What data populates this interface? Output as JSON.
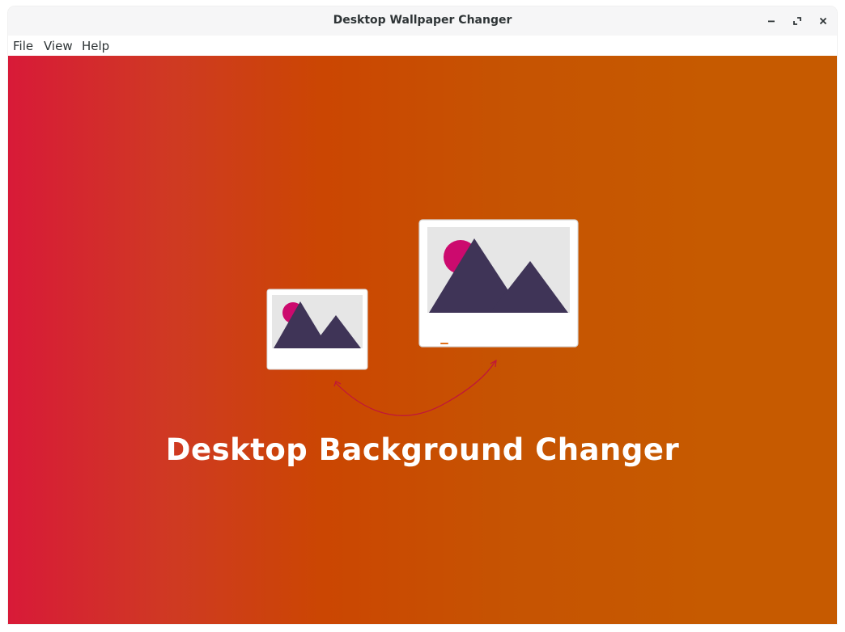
{
  "window": {
    "title": "Desktop Wallpaper Changer"
  },
  "menu": {
    "items": [
      {
        "label": "File"
      },
      {
        "label": "View"
      },
      {
        "label": "Help"
      }
    ]
  },
  "content": {
    "headline": "Desktop Background Changer",
    "colors": {
      "gradient_start": "#d81a38",
      "gradient_mid": "#cb4602",
      "gradient_end": "#c65a00",
      "mountain": "#3f3457",
      "sun": "#cc0a6e",
      "photo_bg": "#e6e6e6",
      "arrow": "#c0143c"
    }
  },
  "icons": {
    "minimize": "minimize-icon",
    "maximize": "maximize-icon",
    "close": "close-icon"
  }
}
